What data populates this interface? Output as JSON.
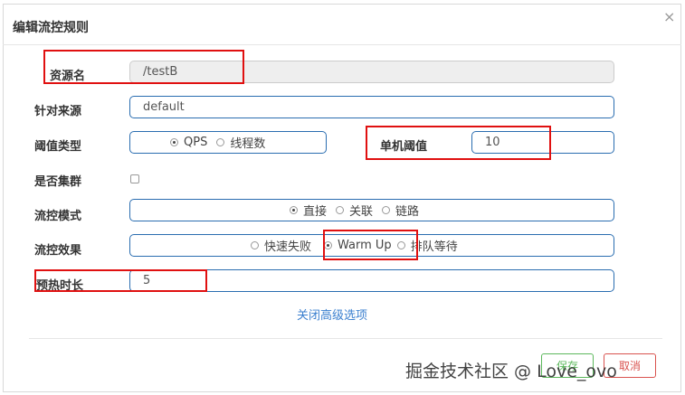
{
  "dialog": {
    "title": "编辑流控规则",
    "close_glyph": "×"
  },
  "form": {
    "resource_label": "资源名",
    "resource_value": "/testB",
    "origin_label": "针对来源",
    "origin_value": "default",
    "threshold_type_label": "阈值类型",
    "threshold_type_options": [
      "QPS",
      "线程数"
    ],
    "threshold_type_selected": "QPS",
    "single_threshold_label": "单机阈值",
    "single_threshold_value": "10",
    "cluster_label": "是否集群",
    "cluster_checked": false,
    "mode_label": "流控模式",
    "mode_options": [
      "直接",
      "关联",
      "链路"
    ],
    "mode_selected": "直接",
    "effect_label": "流控效果",
    "effect_options": [
      "快速失败",
      "Warm Up",
      "排队等待"
    ],
    "effect_selected": "Warm Up",
    "warmup_label": "预热时长",
    "warmup_value": "5",
    "advanced_link": "关闭高级选项"
  },
  "footer": {
    "save_label": "保存",
    "cancel_label": "取消"
  },
  "watermark": "掘金技术社区 @ Love_ovo",
  "colors": {
    "input_border": "#2a6db0",
    "highlight_red": "#e01010",
    "link_blue": "#3a7fcf",
    "save_green": "#5cb85c",
    "cancel_red": "#d9534f"
  }
}
